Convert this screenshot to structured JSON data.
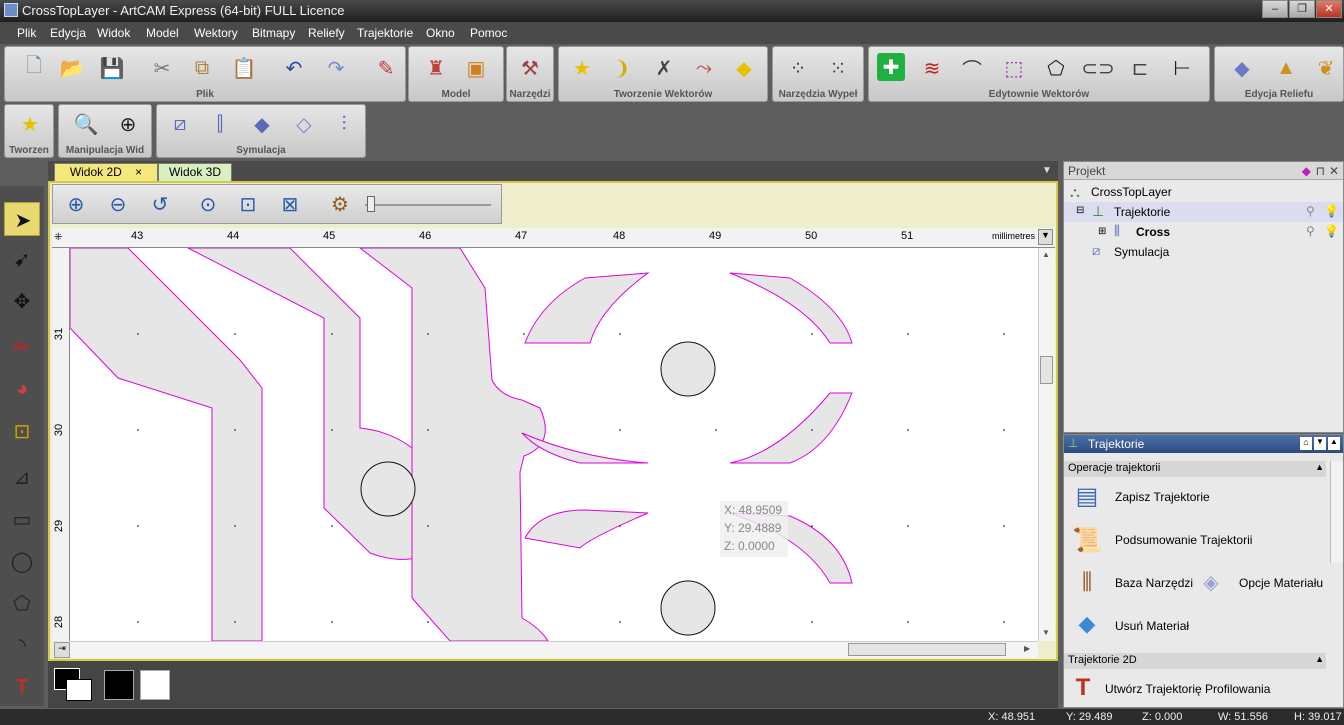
{
  "window": {
    "title": "CrossTopLayer - ArtCAM Express (64-bit) FULL Licence"
  },
  "menu": [
    "Plik",
    "Edycja",
    "Widok",
    "Model",
    "Wektory",
    "Bitmapy",
    "Reliefy",
    "Trajektorie",
    "Okno",
    "Pomoc"
  ],
  "toolbar_groups": {
    "plik": "Plik",
    "model": "Model",
    "narzedzi": "Narzędzi",
    "tworzenie_wektorow": "Tworzenie Wektorów",
    "narzedzia_wypel": "Narzędzia Wypeł",
    "edytownie_wektorow": "Edytownie Wektorów",
    "edycja_reliefu": "Edycja Reliefu",
    "tworzen": "Tworzen",
    "manipulacja_wid": "Manipulacja Wid",
    "symulacja": "Symulacja"
  },
  "tabs": {
    "view2d": "Widok 2D",
    "view3d": "Widok 3D",
    "close": "×"
  },
  "ruler": {
    "h_ticks": [
      "43",
      "44",
      "45",
      "46",
      "47",
      "48",
      "49",
      "50",
      "51"
    ],
    "v_ticks": [
      "31",
      "30",
      "29",
      "28"
    ],
    "unit": "millimetres"
  },
  "cursor_readout": {
    "x": "X: 48.9509",
    "y": "Y: 29.4889",
    "z": "Z: 0.0000"
  },
  "project_panel": {
    "title": "Projekt",
    "root": "CrossTopLayer",
    "trajektorie": "Trajektorie",
    "cross": "Cross",
    "symulacja": "Symulacja"
  },
  "traj_panel": {
    "title": "Trajektorie",
    "section1": "Operacje trajektorii",
    "items": {
      "zapisz": "Zapisz Trajektorie",
      "podsumowanie": "Podsumowanie Trajektorii",
      "baza": "Baza Narzędzi",
      "opcje": "Opcje Materiału",
      "usun": "Usuń Materiał"
    },
    "section2": "Trajektorie 2D",
    "profil": "Utwórz Trajektorię Profilowania"
  },
  "status": {
    "x": "X: 48.951",
    "y": "Y: 29.489",
    "z": "Z: 0.000",
    "w": "W: 51.556",
    "h": "H: 39.017"
  },
  "colors": {
    "accent": "#ffd700",
    "vector": "#e000e0",
    "fill": "#e6e6e6"
  }
}
